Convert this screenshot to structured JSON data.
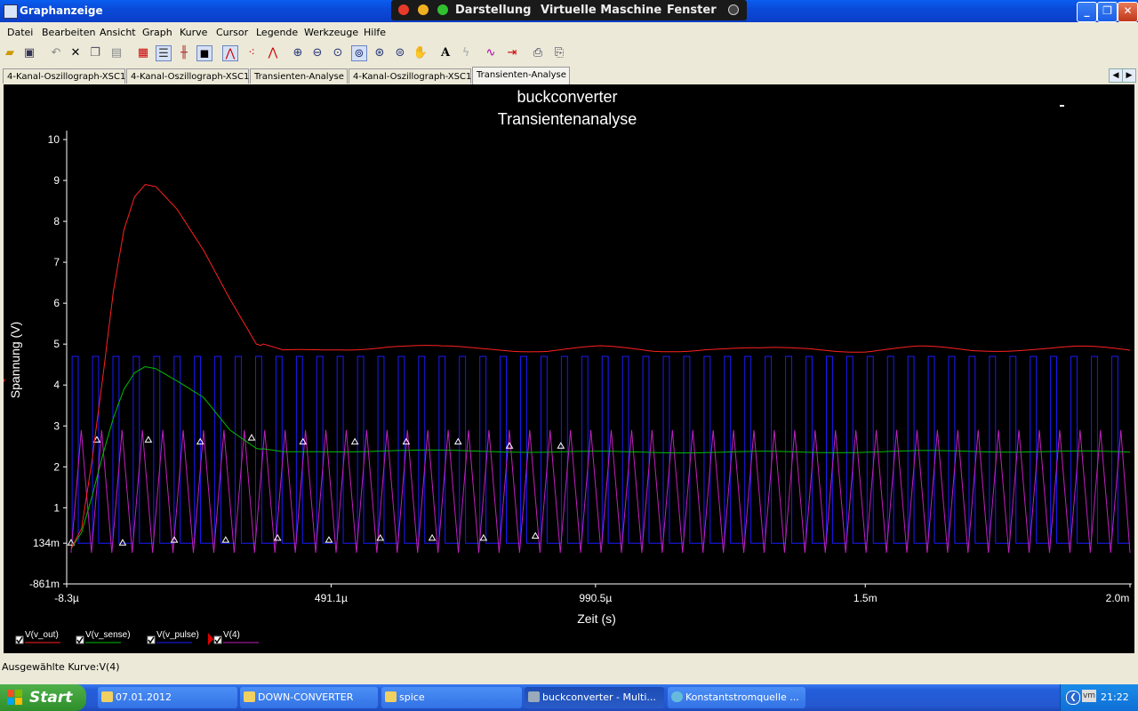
{
  "window": {
    "title": "Graphanzeige",
    "vbox_menu": [
      "Darstellung",
      "Virtuelle Maschine",
      "Fenster"
    ]
  },
  "menubar": [
    "Datei",
    "Bearbeiten",
    "Ansicht",
    "Graph",
    "Kurve",
    "Cursor",
    "Legende",
    "Werkzeuge",
    "Hilfe"
  ],
  "tabs": [
    "4-Kanal-Oszillograph-XSC1",
    "4-Kanal-Oszillograph-XSC1",
    "Transienten-Analyse",
    "4-Kanal-Oszillograph-XSC1",
    "Transienten-Analyse"
  ],
  "active_tab_index": 4,
  "status": {
    "selected_curve": "Ausgewählte Kurve:V(4)"
  },
  "taskbar": {
    "start_label": "Start",
    "tasks": [
      "07.01.2012",
      "DOWN-CONVERTER",
      "spice",
      "buckconverter - Multi...",
      "Konstantstromquelle ..."
    ],
    "clock": "21:22"
  },
  "colors": {
    "v_out": "#ff2020",
    "v_sense": "#00bb00",
    "v_pulse": "#1a1aff",
    "v4": "#c020c0",
    "plot_bg": "#000000"
  },
  "chart_data": {
    "type": "line",
    "title": "buckconverter",
    "subtitle": "Transientenanalyse",
    "xlabel": "Zeit (s)",
    "ylabel": "Spannung (V)",
    "xlim": [
      -8.3e-06,
      0.002
    ],
    "ylim": [
      -0.861,
      10
    ],
    "x_tick_labels": [
      "-8.3µ",
      "491.1µ",
      "990.5µ",
      "1.5m",
      "2.0m"
    ],
    "x_tick_values": [
      -8.3e-06,
      0.0004911,
      0.0009905,
      0.0015,
      0.002
    ],
    "y_tick_labels": [
      "10",
      "9",
      "8",
      "7",
      "6",
      "5",
      "4",
      "3",
      "2",
      "1",
      "134m",
      "-861m"
    ],
    "y_tick_values": [
      10,
      9,
      8,
      7,
      6,
      5,
      4,
      3,
      2,
      1,
      0.134,
      -0.861
    ],
    "legend_position": "bottom-left",
    "series": [
      {
        "name": "V(v_out)",
        "x": [
          0,
          2e-05,
          4e-05,
          6e-05,
          8e-05,
          0.0001,
          0.00012,
          0.00014,
          0.00016,
          0.0002,
          0.00025,
          0.0003,
          0.00035,
          0.0004,
          0.00045,
          0.0005,
          0.0006,
          0.0007,
          0.0008,
          0.0009,
          0.001,
          0.0011,
          0.0012,
          0.0013,
          0.0014,
          0.0015,
          0.0016,
          0.0017,
          0.0018,
          0.0019,
          0.002
        ],
        "values": [
          0,
          0.5,
          2.2,
          4.2,
          6.3,
          7.8,
          8.6,
          8.9,
          8.85,
          8.3,
          7.3,
          6.1,
          5.0,
          4.8,
          4.85,
          4.9,
          4.95,
          4.9,
          4.9,
          4.85,
          4.9,
          4.85,
          4.9,
          4.85,
          4.9,
          4.85,
          4.9,
          4.85,
          4.9,
          4.9,
          4.85
        ]
      },
      {
        "name": "V(v_sense)",
        "x": [
          0,
          2e-05,
          4e-05,
          6e-05,
          8e-05,
          0.0001,
          0.00012,
          0.00014,
          0.00016,
          0.0002,
          0.00025,
          0.0003,
          0.00035,
          0.0004,
          0.0005,
          0.0006,
          0.0008,
          0.001,
          0.0012,
          0.0014,
          0.0016,
          0.0018,
          0.002
        ],
        "values": [
          0,
          0.4,
          1.3,
          2.3,
          3.2,
          3.9,
          4.3,
          4.45,
          4.4,
          4.1,
          3.7,
          2.9,
          2.45,
          2.35,
          2.38,
          2.4,
          2.38,
          2.36,
          2.36,
          2.36,
          2.38,
          2.38,
          2.36
        ]
      },
      {
        "name": "V(v_pulse)",
        "low": 0.134,
        "high": 4.7,
        "period": 3.85e-05,
        "duty": 0.3,
        "start": 8.3e-06
      },
      {
        "name": "V(4)",
        "min": -0.1,
        "max": 2.9,
        "period": 3.85e-05,
        "marker_x": [
          0,
          4.87e-05,
          9.74e-05,
          0.000146,
          0.000195,
          0.000244,
          0.000292,
          0.000341,
          0.00039,
          0.000438,
          0.000487,
          0.000536,
          0.000584,
          0.000633,
          0.000682,
          0.000731,
          0.000779,
          0.000828,
          0.000877,
          0.000925
        ],
        "marker_y": [
          0.134,
          2.65,
          0.134,
          2.65,
          0.2,
          2.6,
          0.2,
          2.7,
          0.25,
          2.6,
          0.2,
          2.6,
          0.25,
          2.6,
          0.25,
          2.6,
          0.25,
          2.5,
          0.3,
          2.5
        ]
      }
    ]
  }
}
